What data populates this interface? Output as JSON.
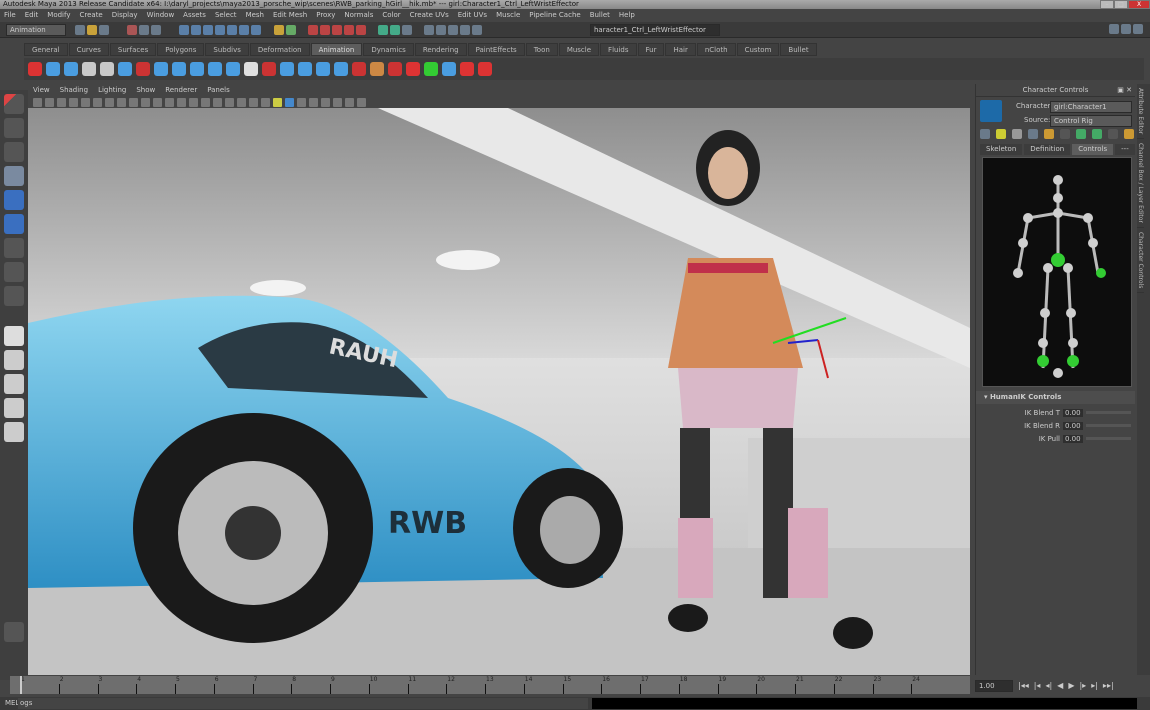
{
  "title": "Autodesk Maya 2013 Release Candidate x64: I:\\daryl_projects\\maya2013_porsche_wip\\scenes\\RWB_parking_hGirl__hik.mb*   ---   girl:Character1_Ctrl_LeftWristEffector",
  "window_controls": {
    "minimize": "–",
    "maximize": "□",
    "close": "X"
  },
  "menu": [
    "File",
    "Edit",
    "Modify",
    "Create",
    "Display",
    "Window",
    "Assets",
    "Select",
    "Mesh",
    "Edit Mesh",
    "Proxy",
    "Normals",
    "Color",
    "Create UVs",
    "Edit UVs",
    "Muscle",
    "Pipeline Cache",
    "Bullet",
    "Help"
  ],
  "status_line": {
    "mode": "Animation",
    "selection_field": "haracter1_Ctrl_LeftWristEffector"
  },
  "shelf_tabs": [
    "General",
    "Curves",
    "Surfaces",
    "Polygons",
    "Subdivs",
    "Deformation",
    "Animation",
    "Dynamics",
    "Rendering",
    "PaintEffects",
    "Toon",
    "Muscle",
    "Fluids",
    "Fur",
    "Hair",
    "nCloth",
    "Custom",
    "Bullet"
  ],
  "active_shelf": "Animation",
  "panel_menu": [
    "View",
    "Shading",
    "Lighting",
    "Show",
    "Renderer",
    "Panels"
  ],
  "viewport": {
    "car_text": "RWB",
    "car_window_text": "RAUH"
  },
  "character_controls": {
    "header": "Character Controls",
    "character_label": "Character:",
    "character_value": "girl:Character1",
    "source_label": "Source:",
    "source_value": "Control Rig",
    "tabs": [
      "Skeleton",
      "Definition",
      "Controls",
      "---"
    ],
    "active_tab": "Controls",
    "section": "HumanIK Controls",
    "fields": [
      {
        "label": "IK Blend T",
        "value": "0.00"
      },
      {
        "label": "IK Blend R",
        "value": "0.00"
      },
      {
        "label": "IK Pull",
        "value": "0.00"
      }
    ]
  },
  "side_tabs": [
    "Attribute Editor",
    "Channel Box / Layer Editor",
    "Character Controls"
  ],
  "timeline": {
    "ticks": [
      "1",
      "2",
      "3",
      "4",
      "5",
      "6",
      "7",
      "8",
      "9",
      "10",
      "11",
      "12",
      "13",
      "14",
      "15",
      "16",
      "17",
      "18",
      "19",
      "20",
      "21",
      "22",
      "23",
      "24"
    ],
    "current_frame": "1.00"
  },
  "playback": [
    "go-start",
    "step-back-key",
    "step-back",
    "play-back",
    "play-forward",
    "step-forward",
    "step-forward-key",
    "go-end"
  ],
  "command_line": {
    "label": "MEL",
    "value": "ogs"
  }
}
